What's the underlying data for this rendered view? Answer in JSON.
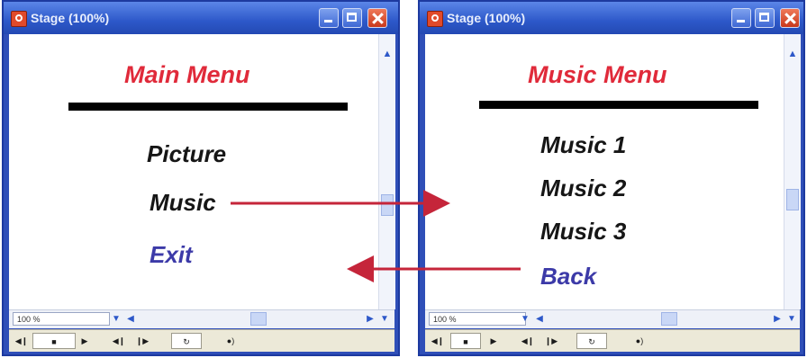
{
  "left_window": {
    "title": "Stage (100%)",
    "heading": "Main Menu",
    "items": [
      "Picture",
      "Music",
      "Exit"
    ],
    "zoom": "100 %"
  },
  "right_window": {
    "title": "Stage (100%)",
    "heading": "Music Menu",
    "items": [
      "Music 1",
      "Music 2",
      "Music 3",
      "Back"
    ],
    "zoom": "100 %"
  },
  "colors": {
    "heading": "#e02a3a",
    "item": "#161616",
    "nav_item": "#3c3aa8",
    "arrow": "#c5253a",
    "titlebar": "#2d58c9"
  },
  "icons": {
    "app": "flash-stage-icon",
    "minimize": "minimize-icon",
    "maximize": "maximize-icon",
    "close": "close-icon",
    "controller": [
      "rewind-icon",
      "stop-icon",
      "play-icon",
      "step-back-icon",
      "step-forward-icon",
      "loop-icon",
      "volume-icon"
    ]
  }
}
